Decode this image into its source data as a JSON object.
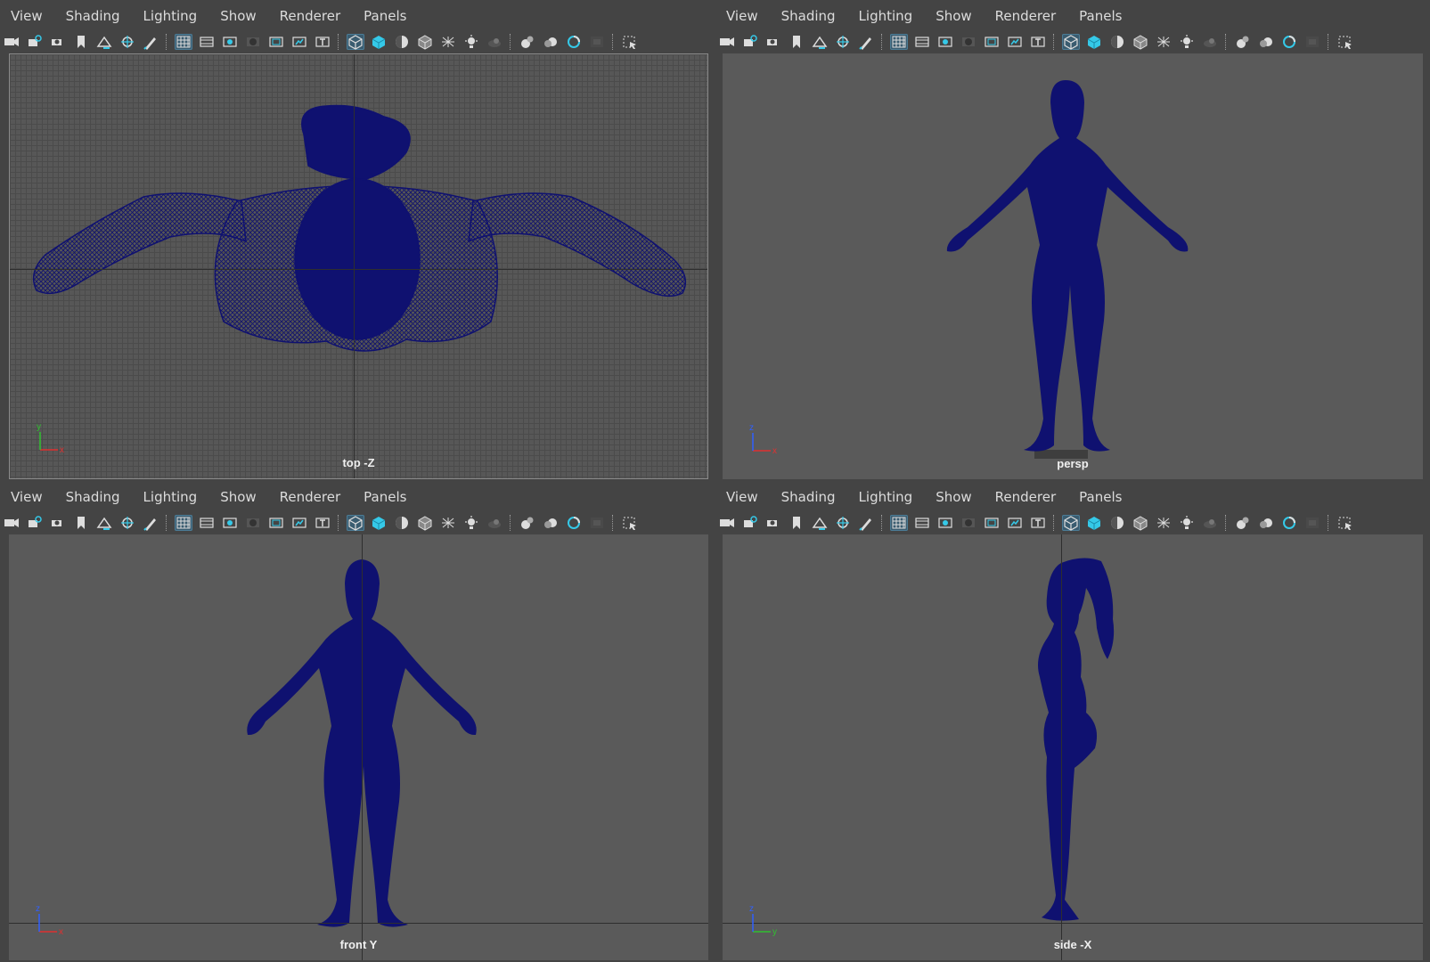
{
  "menu": [
    "View",
    "Shading",
    "Lighting",
    "Show",
    "Renderer",
    "Panels"
  ],
  "toolbar_icons": [
    "camera-icon",
    "camera-lock-icon",
    "camera-attributes-icon",
    "bookmark-icon",
    "image-plane-icon",
    "grid-snap-icon",
    "pencil-icon",
    "|",
    "grid-icon",
    "film-gate-icon",
    "resolution-gate-icon",
    "gate-mask-icon",
    "field-chart-icon",
    "safe-action-icon",
    "safe-title-icon",
    "|",
    "wireframe-icon",
    "smooth-shade-icon",
    "default-material-icon",
    "wireframe-on-shaded-icon",
    "xray-icon",
    "use-all-lights-icon",
    "shadows-icon",
    "|",
    "screen-space-ao-icon",
    "motion-blur-icon",
    "anti-alias-icon",
    "depth-of-field-icon",
    "|",
    "select-camera-icon"
  ],
  "panes": [
    {
      "label": "top -Z",
      "axes": [
        "y",
        "x"
      ]
    },
    {
      "label": "persp",
      "axes": [
        "z",
        "x"
      ]
    },
    {
      "label": "front Y",
      "axes": [
        "z",
        "x"
      ]
    },
    {
      "label": "side -X",
      "axes": [
        "z",
        "y"
      ]
    }
  ],
  "colors": {
    "wire": "#0f1170",
    "axis_x": "#e03030",
    "axis_y": "#30c030",
    "axis_z": "#3060ff",
    "active_tool": "#3a5c70",
    "icon_cyan": "#35c9e8"
  }
}
